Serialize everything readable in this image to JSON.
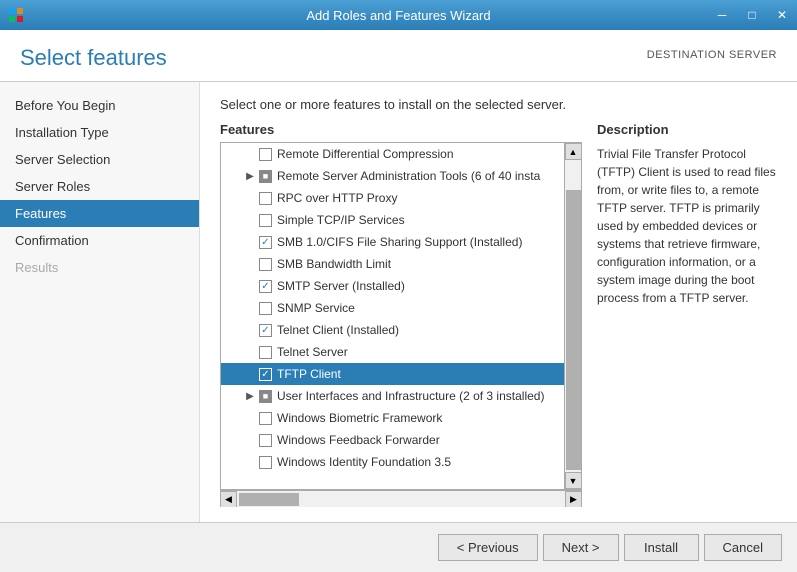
{
  "titleBar": {
    "title": "Add Roles and Features Wizard",
    "minBtn": "─",
    "maxBtn": "□",
    "closeBtn": "✕"
  },
  "header": {
    "pageTitle": "Select features",
    "destinationLabel": "DESTINATION SERVER"
  },
  "sidebar": {
    "items": [
      {
        "id": "before-you-begin",
        "label": "Before You Begin",
        "state": "normal"
      },
      {
        "id": "installation-type",
        "label": "Installation Type",
        "state": "normal"
      },
      {
        "id": "server-selection",
        "label": "Server Selection",
        "state": "normal"
      },
      {
        "id": "server-roles",
        "label": "Server Roles",
        "state": "normal"
      },
      {
        "id": "features",
        "label": "Features",
        "state": "active"
      },
      {
        "id": "confirmation",
        "label": "Confirmation",
        "state": "normal"
      },
      {
        "id": "results",
        "label": "Results",
        "state": "disabled"
      }
    ]
  },
  "mainContent": {
    "instructionText": "Select one or more features to install on the selected server.",
    "featuresLabel": "Features",
    "descriptionLabel": "Description",
    "descriptionText": "Trivial File Transfer Protocol (TFTP) Client is used to read files from, or write files to, a remote TFTP server. TFTP is primarily used by embedded devices or systems that retrieve firmware, configuration information, or a system image during the boot process from a TFTP server.",
    "features": [
      {
        "id": "remote-diff",
        "label": "Remote Differential Compression",
        "indent": 1,
        "checked": "none",
        "expandable": false,
        "selected": false
      },
      {
        "id": "rsat",
        "label": "Remote Server Administration Tools (6 of 40 insta",
        "indent": 1,
        "checked": "partial",
        "expandable": true,
        "selected": false
      },
      {
        "id": "rpc-proxy",
        "label": "RPC over HTTP Proxy",
        "indent": 1,
        "checked": "none",
        "expandable": false,
        "selected": false
      },
      {
        "id": "simple-tcp",
        "label": "Simple TCP/IP Services",
        "indent": 1,
        "checked": "none",
        "expandable": false,
        "selected": false
      },
      {
        "id": "smb1",
        "label": "SMB 1.0/CIFS File Sharing Support (Installed)",
        "indent": 1,
        "checked": "checked",
        "expandable": false,
        "selected": false
      },
      {
        "id": "smb-bw",
        "label": "SMB Bandwidth Limit",
        "indent": 1,
        "checked": "none",
        "expandable": false,
        "selected": false
      },
      {
        "id": "smtp",
        "label": "SMTP Server (Installed)",
        "indent": 1,
        "checked": "checked",
        "expandable": false,
        "selected": false
      },
      {
        "id": "snmp",
        "label": "SNMP Service",
        "indent": 1,
        "checked": "none",
        "expandable": false,
        "selected": false
      },
      {
        "id": "telnet-client",
        "label": "Telnet Client (Installed)",
        "indent": 1,
        "checked": "checked",
        "expandable": false,
        "selected": false
      },
      {
        "id": "telnet-server",
        "label": "Telnet Server",
        "indent": 1,
        "checked": "none",
        "expandable": false,
        "selected": false
      },
      {
        "id": "tftp-client",
        "label": "TFTP Client",
        "indent": 1,
        "checked": "checked-blue",
        "expandable": false,
        "selected": true
      },
      {
        "id": "ui-infra",
        "label": "User Interfaces and Infrastructure (2 of 3 installed)",
        "indent": 1,
        "checked": "partial",
        "expandable": true,
        "selected": false
      },
      {
        "id": "win-biometric",
        "label": "Windows Biometric Framework",
        "indent": 1,
        "checked": "none",
        "expandable": false,
        "selected": false
      },
      {
        "id": "win-feedback",
        "label": "Windows Feedback Forwarder",
        "indent": 1,
        "checked": "none",
        "expandable": false,
        "selected": false
      },
      {
        "id": "win-identity",
        "label": "Windows Identity Foundation 3.5",
        "indent": 1,
        "checked": "none",
        "expandable": false,
        "selected": false
      }
    ]
  },
  "footer": {
    "prevLabel": "< Previous",
    "nextLabel": "Next >",
    "installLabel": "Install",
    "cancelLabel": "Cancel"
  }
}
